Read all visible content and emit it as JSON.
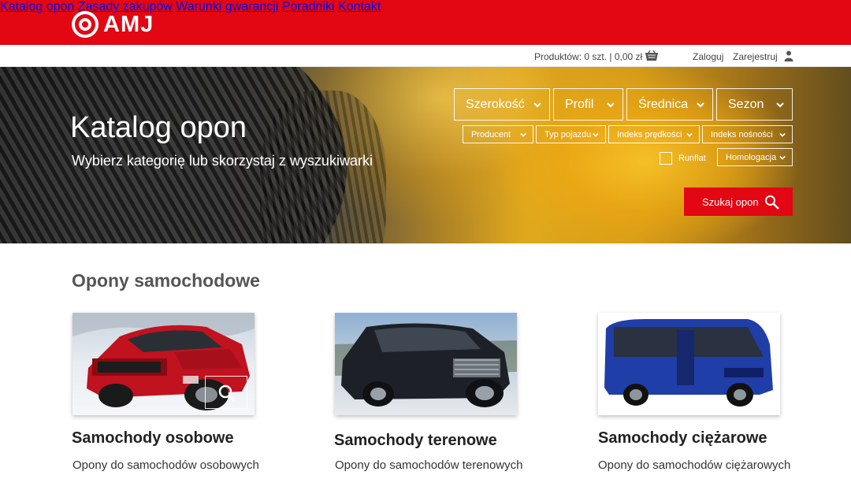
{
  "brand": {
    "name": "AMJ"
  },
  "nav": {
    "items": [
      {
        "label": "Katalog opon"
      },
      {
        "label": "Zasady zakupów"
      },
      {
        "label": "Warunki gwarancji"
      },
      {
        "label": "Poradniki"
      },
      {
        "label": "Kontakt"
      }
    ]
  },
  "util": {
    "cart_text": "Produktów: 0 szt. | 0,00 zł",
    "login": "Zaloguj",
    "register": "Zarejestruj"
  },
  "hero": {
    "title": "Katalog opon",
    "subtitle": "Wybierz kategorię lub skorzystaj z wyszukiwarki",
    "filters_main": [
      "Szerokość",
      "Profil",
      "Średnica",
      "Sezon"
    ],
    "filters_secondary": [
      "Producent",
      "Typ pojazdu",
      "Indeks prędkości",
      "Indeks nośności"
    ],
    "homologation": "Homologacja",
    "runflat_label": "Runflat",
    "search_button": "Szukaj opon"
  },
  "section": {
    "title": "Opony samochodowe",
    "cards": [
      {
        "title": "Samochody osobowe",
        "desc": "Opony do samochodów osobowych"
      },
      {
        "title": "Samochody terenowe",
        "desc": "Opony do samochodów terenowych"
      },
      {
        "title": "Samochody ciężarowe",
        "desc": "Opony do samochodów ciężarowych"
      }
    ]
  },
  "colors": {
    "brand_red": "#e30613",
    "text_dark": "#222222",
    "section_gray": "#555555"
  },
  "icons": [
    "logo-target-icon",
    "basket-icon",
    "user-icon",
    "chevron-down-icon",
    "search-icon",
    "zoom-icon"
  ]
}
